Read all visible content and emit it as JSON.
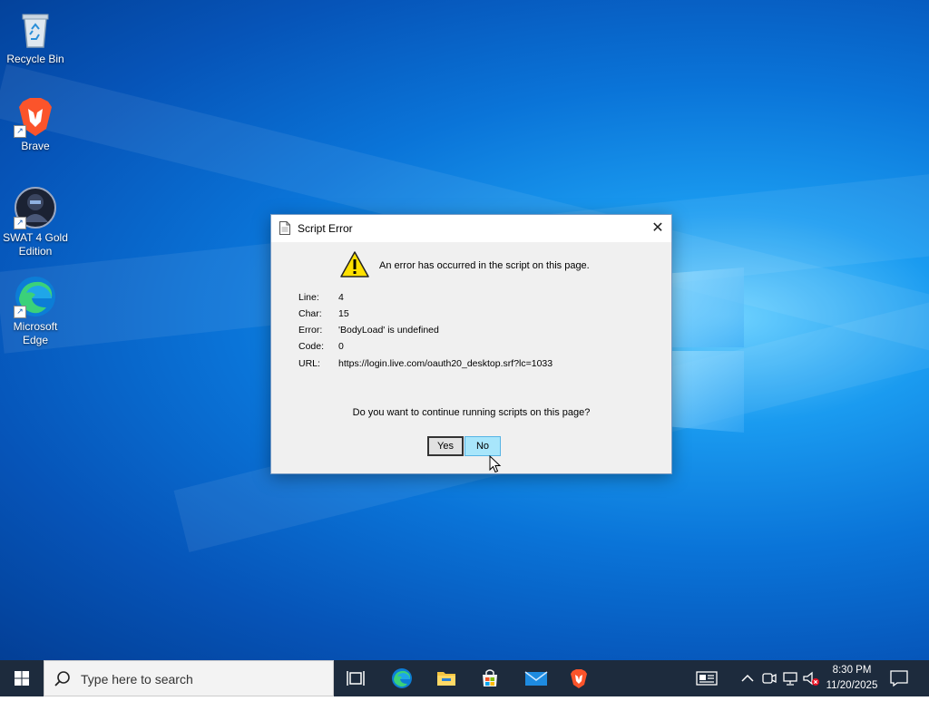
{
  "desktop": {
    "icons": [
      {
        "label": "Recycle Bin",
        "icon": "recycle-bin-icon"
      },
      {
        "label": "Brave",
        "icon": "brave-icon"
      },
      {
        "label": "SWAT 4 Gold Edition",
        "icon": "swat4-icon"
      },
      {
        "label": "Microsoft Edge",
        "icon": "edge-icon"
      }
    ]
  },
  "dialog": {
    "title": "Script Error",
    "message": "An error has occurred in the script on this page.",
    "fields": [
      {
        "label": "Line:",
        "value": "4"
      },
      {
        "label": "Char:",
        "value": "15"
      },
      {
        "label": "Error:",
        "value": "'BodyLoad' is undefined"
      },
      {
        "label": "Code:",
        "value": "0"
      },
      {
        "label": "URL:",
        "value": "https://login.live.com/oauth20_desktop.srf?lc=1033"
      }
    ],
    "question": "Do you want to continue running scripts on this page?",
    "yes_label": "Yes",
    "no_label": "No",
    "close_glyph": "✕"
  },
  "taskbar": {
    "search_placeholder": "Type here to search",
    "pinned": [
      "task-view-icon",
      "edge-icon",
      "file-explorer-icon",
      "store-icon",
      "mail-icon",
      "brave-icon"
    ],
    "tray": [
      "news-icon",
      "chevron-up-icon",
      "meet-icon",
      "network-icon",
      "volume-muted-icon"
    ],
    "clock_time": "8:30 PM",
    "clock_date": "11/20/2025"
  },
  "colors": {
    "taskbar_bg": "#1d2b3d",
    "no_button_bg": "#a8e6fb",
    "desktop_accent": "#0a74d8"
  }
}
